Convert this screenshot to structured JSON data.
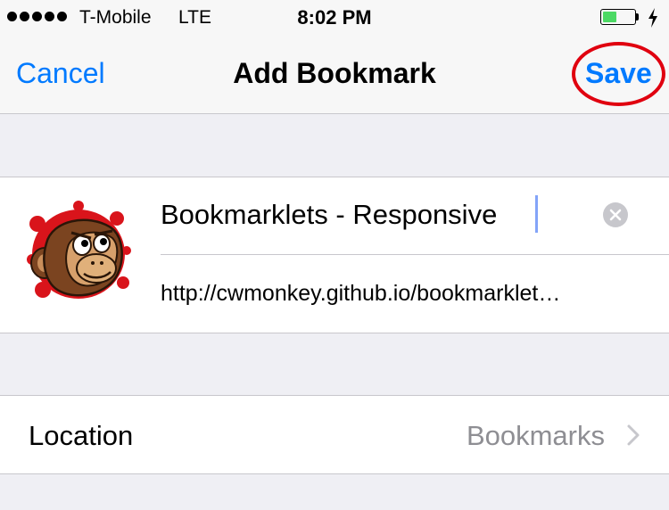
{
  "status_bar": {
    "signal_dots": 5,
    "carrier": "T-Mobile",
    "network": "LTE",
    "time": "8:02 PM",
    "battery_level": 0.45,
    "battery_color": "#4cd964",
    "charging_icon": "bolt-icon"
  },
  "nav": {
    "cancel_label": "Cancel",
    "title": "Add Bookmark",
    "save_label": "Save",
    "accent": "#007aff",
    "highlight_color": "#e0000f"
  },
  "bookmark": {
    "favicon_icon": "monkey-favicon",
    "title_value": "Bookmarklets - Responsive",
    "clear_icon": "clear-x-icon",
    "url": "http://cwmonkey.github.io/bookmarklet…"
  },
  "location": {
    "label": "Location",
    "value": "Bookmarks",
    "chevron_icon": "chevron-right-icon"
  }
}
